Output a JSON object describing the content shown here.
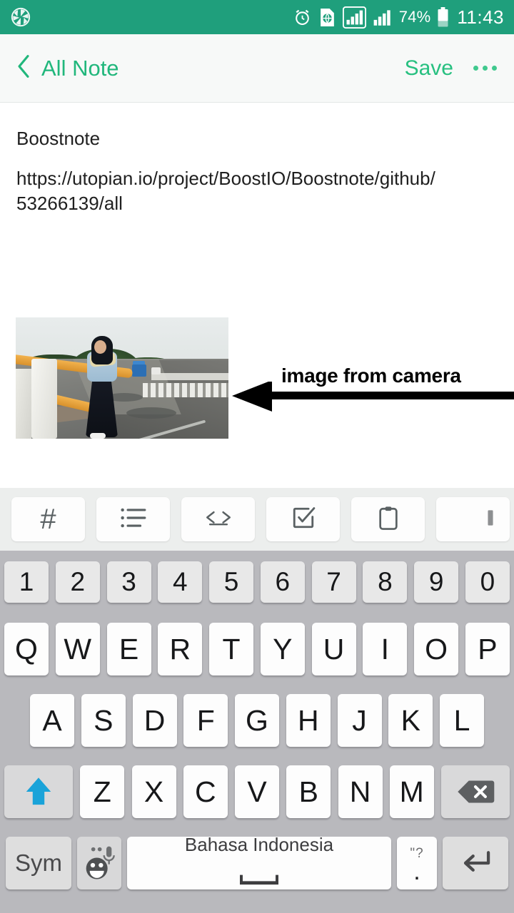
{
  "status_bar": {
    "background_color": "#1f9f7c",
    "left_icons": [
      {
        "name": "camera-aperture-icon",
        "label": "camera"
      }
    ],
    "right_icons": [
      {
        "name": "alarm-clock-icon",
        "label": "alarm"
      },
      {
        "name": "globe-sim-icon",
        "label": "data-globe"
      },
      {
        "name": "signal-bars-sim1-icon",
        "label": "signal-1"
      },
      {
        "name": "signal-bars-sim2-icon",
        "label": "signal-2"
      }
    ],
    "battery_percent": "74%",
    "battery_icon": "battery-icon",
    "clock": "11:43"
  },
  "app_bar": {
    "back_icon": "chevron-left-icon",
    "back_label": "All Note",
    "save_label": "Save",
    "overflow_icon": "more-options-icon",
    "title_color": "#21b77c",
    "save_color": "#27c080",
    "background_color": "#f7f9f8"
  },
  "note": {
    "title": "Boostnote",
    "url": "https://utopian.io/project/BoostIO/Boostnote/github/53266139/all",
    "image_alt": "photo of a woman standing on a bridge railing beside a road",
    "divider_color": "#1d9b7e"
  },
  "annotation": {
    "text": "image from camera",
    "arrow": "left-arrow-annotation",
    "color": "#000000"
  },
  "md_toolbar": {
    "background_color": "#eceeed",
    "buttons": [
      {
        "name": "heading-hash-button",
        "glyph": "#",
        "label": "heading"
      },
      {
        "name": "bullet-list-button",
        "glyph": "list",
        "label": "bullet list"
      },
      {
        "name": "code-block-button",
        "glyph": "code",
        "label": "code"
      },
      {
        "name": "checkbox-task-button",
        "glyph": "checkbox",
        "label": "task"
      },
      {
        "name": "clipboard-paste-button",
        "glyph": "clipboard",
        "label": "paste"
      },
      {
        "name": "partial-cut-off-button",
        "glyph": "partial",
        "label": "more"
      }
    ]
  },
  "keyboard": {
    "background_color": "#b9b9bd",
    "language_label": "Bahasa Indonesia",
    "number_row": [
      "1",
      "2",
      "3",
      "4",
      "5",
      "6",
      "7",
      "8",
      "9",
      "0"
    ],
    "row1": [
      "Q",
      "W",
      "E",
      "R",
      "T",
      "Y",
      "U",
      "I",
      "O",
      "P"
    ],
    "row2": [
      "A",
      "S",
      "D",
      "F",
      "G",
      "H",
      "J",
      "K",
      "L"
    ],
    "row3": [
      "Z",
      "X",
      "C",
      "V",
      "B",
      "N",
      "M"
    ],
    "shift_key": {
      "name": "shift-key",
      "icon": "up-arrow-icon",
      "color": "#1aa3d9"
    },
    "backspace_key": {
      "name": "backspace-key",
      "icon": "backspace-icon"
    },
    "sym_key": {
      "name": "symbols-key",
      "label": "Sym"
    },
    "emoji_key": {
      "name": "emoji-mic-key",
      "icon": "smiley-microphone-icon"
    },
    "space_key": {
      "name": "space-key",
      "icon": "space-bar-icon"
    },
    "period_key": {
      "name": "period-key",
      "top_label": "\"?",
      "label": "."
    },
    "enter_key": {
      "name": "enter-key",
      "icon": "enter-arrow-icon"
    }
  }
}
